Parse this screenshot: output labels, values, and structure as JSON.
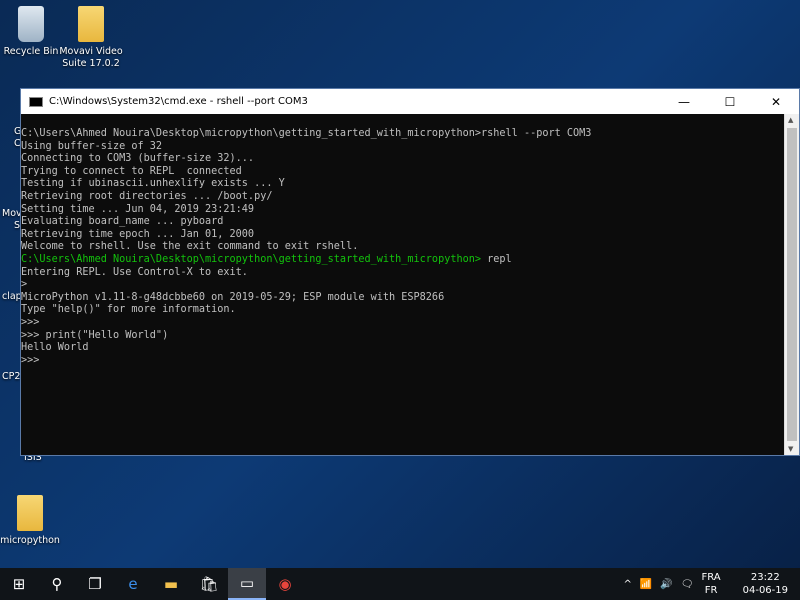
{
  "desktop": {
    "icons": [
      {
        "label": "Recycle Bin"
      },
      {
        "label": "Movavi Video Suite 17.0.2"
      },
      {
        "label": "micropython"
      }
    ],
    "partial_labels": [
      "G",
      "C",
      "Mov",
      "S",
      "clap",
      "CP2",
      "ISIS"
    ]
  },
  "window": {
    "title": "C:\\Windows\\System32\\cmd.exe - rshell  --port COM3",
    "minimize": "—",
    "maximize": "☐",
    "close": "✕"
  },
  "terminal": {
    "lines": [
      {
        "text": "C:\\Users\\Ahmed Nouira\\Desktop\\micropython\\getting_started_with_micropython>rshell --port COM3"
      },
      {
        "text": "Using buffer-size of 32"
      },
      {
        "text": "Connecting to COM3 (buffer-size 32)..."
      },
      {
        "text": "Trying to connect to REPL  connected"
      },
      {
        "text": "Testing if ubinascii.unhexlify exists ... Y"
      },
      {
        "text": "Retrieving root directories ... /boot.py/"
      },
      {
        "text": "Setting time ... Jun 04, 2019 23:21:49"
      },
      {
        "text": "Evaluating board_name ... pyboard"
      },
      {
        "text": "Retrieving time epoch ... Jan 01, 2000"
      },
      {
        "text": "Welcome to rshell. Use the exit command to exit rshell."
      },
      {
        "prompt": "C:\\Users\\Ahmed Nouira\\Desktop\\micropython\\getting_started_with_micropython>",
        "text": " repl"
      },
      {
        "text": "Entering REPL. Use Control-X to exit."
      },
      {
        "text": ">"
      },
      {
        "text": "MicroPython v1.11-8-g48dcbbe60 on 2019-05-29; ESP module with ESP8266"
      },
      {
        "text": "Type \"help()\" for more information."
      },
      {
        "text": ">>>"
      },
      {
        "text": ">>> print(\"Hello World\")"
      },
      {
        "text": "Hello World"
      },
      {
        "text": ">>>"
      }
    ],
    "prompt_color": "#13c30d"
  },
  "taskbar": {
    "lang_top": "FRA",
    "lang_bottom": "FR",
    "time": "23:22",
    "date": "04-06-19"
  }
}
